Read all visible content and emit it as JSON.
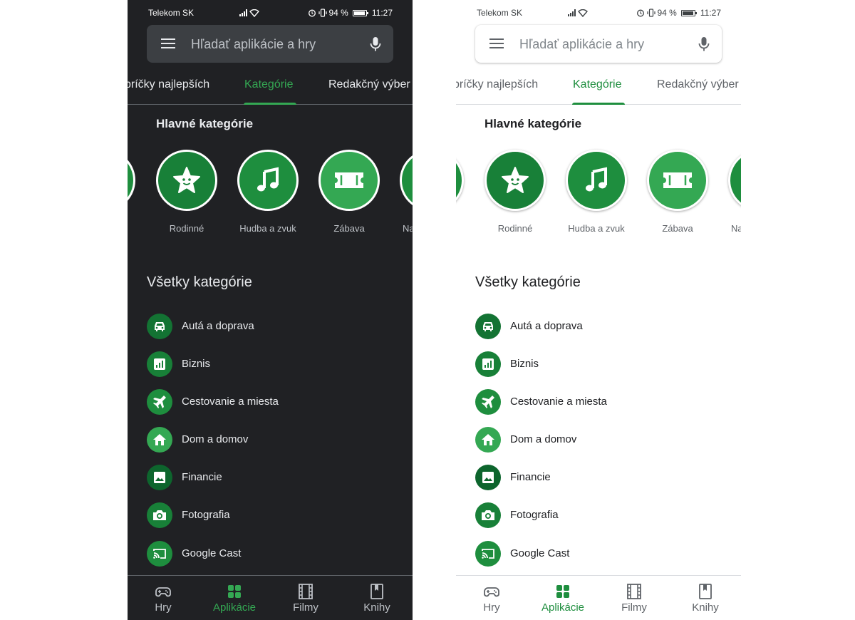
{
  "status": {
    "carrier": "Telekom SK",
    "battery": "94 %",
    "time": "11:27"
  },
  "search": {
    "placeholder": "Hľadať aplikácie a hry"
  },
  "tabs": [
    {
      "label": "rebríčky najlepších",
      "shown": "bríčky najlepších",
      "active": false
    },
    {
      "label": "Kategórie",
      "active": true
    },
    {
      "label": "Redakčný výber",
      "active": false
    }
  ],
  "main_categories": {
    "title": "Hlavné kategórie",
    "items": [
      {
        "label": "Rodinné",
        "icon": "star-face-icon"
      },
      {
        "label": "Hudba a zvuk",
        "icon": "music-note-icon"
      },
      {
        "label": "Zábava",
        "icon": "ticket-icon"
      },
      {
        "label": "Na",
        "icon": "unknown-icon"
      }
    ]
  },
  "all_categories": {
    "title": "Všetky kategórie",
    "items": [
      {
        "label": "Autá a doprava",
        "icon": "car-icon",
        "color": "#137333"
      },
      {
        "label": "Biznis",
        "icon": "bar-chart-icon",
        "color": "#188038"
      },
      {
        "label": "Cestovanie a miesta",
        "icon": "airplane-icon",
        "color": "#1e8e3e"
      },
      {
        "label": "Dom a domov",
        "icon": "home-icon",
        "color": "#34a853"
      },
      {
        "label": "Financie",
        "icon": "image-icon",
        "color": "#0d652d"
      },
      {
        "label": "Fotografia",
        "icon": "camera-icon",
        "color": "#188038"
      },
      {
        "label": "Google Cast",
        "icon": "cast-icon",
        "color": "#1e8e3e"
      }
    ]
  },
  "bottom_nav": [
    {
      "label": "Hry",
      "icon": "gamepad-icon",
      "active": false
    },
    {
      "label": "Aplikácie",
      "icon": "apps-grid-icon",
      "active": true
    },
    {
      "label": "Filmy",
      "icon": "film-icon",
      "active": false
    },
    {
      "label": "Knihy",
      "icon": "book-icon",
      "active": false
    }
  ],
  "colors": {
    "accent_light": "#1e8e3e",
    "accent_dark": "#34a853",
    "dark_background": "#202124",
    "light_background": "#ffffff"
  }
}
